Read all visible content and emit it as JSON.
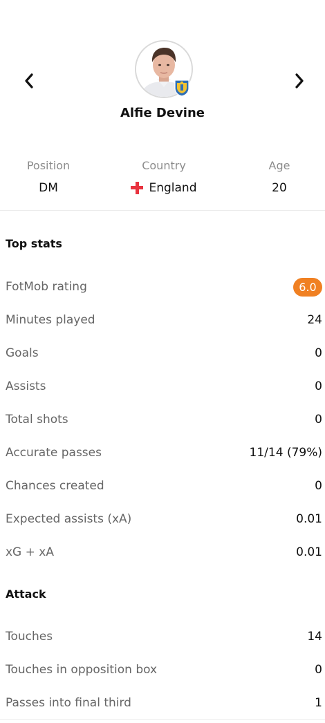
{
  "player": {
    "name": "Alfie Devine",
    "avatar_icon": "player-photo",
    "club_badge_icon": "club-crest-icon"
  },
  "nav": {
    "prev_icon": "chevron-left-icon",
    "next_icon": "chevron-right-icon"
  },
  "info": {
    "position": {
      "label": "Position",
      "value": "DM"
    },
    "country": {
      "label": "Country",
      "value": "England",
      "flag_icon": "england-flag-icon"
    },
    "age": {
      "label": "Age",
      "value": "20"
    }
  },
  "top_stats": {
    "title": "Top stats",
    "rating": {
      "label": "FotMob rating",
      "value": "6.0",
      "color": "#f08022"
    },
    "rows": [
      {
        "label": "Minutes played",
        "value": "24"
      },
      {
        "label": "Goals",
        "value": "0"
      },
      {
        "label": "Assists",
        "value": "0"
      },
      {
        "label": "Total shots",
        "value": "0"
      },
      {
        "label": "Accurate passes",
        "value": "11/14 (79%)"
      },
      {
        "label": "Chances created",
        "value": "0"
      },
      {
        "label": "Expected assists (xA)",
        "value": "0.01"
      },
      {
        "label": "xG + xA",
        "value": "0.01"
      }
    ]
  },
  "attack": {
    "title": "Attack",
    "rows": [
      {
        "label": "Touches",
        "value": "14"
      },
      {
        "label": "Touches in opposition box",
        "value": "0"
      },
      {
        "label": "Passes into final third",
        "value": "1"
      }
    ]
  }
}
